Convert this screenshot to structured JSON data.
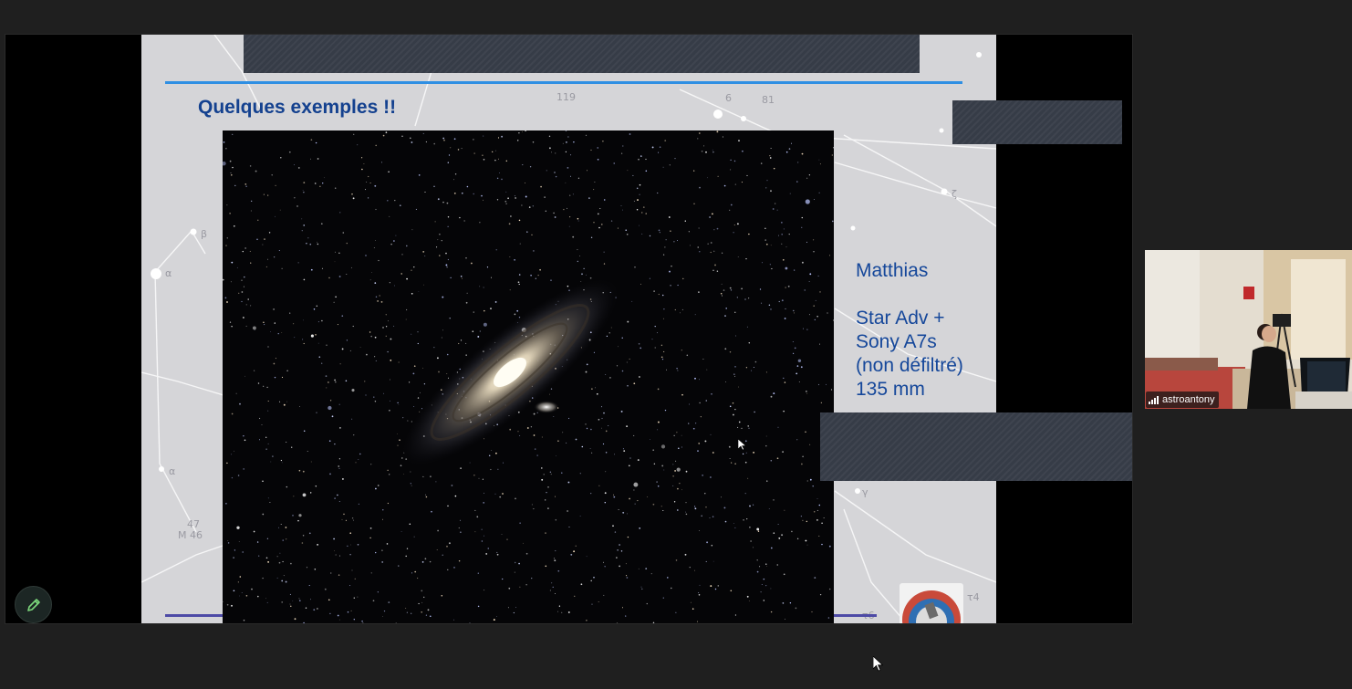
{
  "slide": {
    "title": "Quelques exemples !!",
    "caption": {
      "author": "Matthias",
      "equipment_lines": [
        "Star Adv +",
        "Sony A7s",
        "(non défiltré)",
        "135 mm"
      ]
    },
    "photo_subject_icon": "galaxy-photo"
  },
  "participant": {
    "name": "astroantony",
    "signal_icon": "signal-bars-icon"
  },
  "toolbar": {
    "annotate_icon": "pencil-icon"
  },
  "colors": {
    "background": "#1f1f1f",
    "slide_title": "#14418f",
    "slide_caption": "#15479a",
    "slide_top_bar": "#2f8fe3",
    "slide_bottom_bar": "#4d4aa6",
    "redaction": "#363c47",
    "annotate_icon": "#7bd67b"
  }
}
